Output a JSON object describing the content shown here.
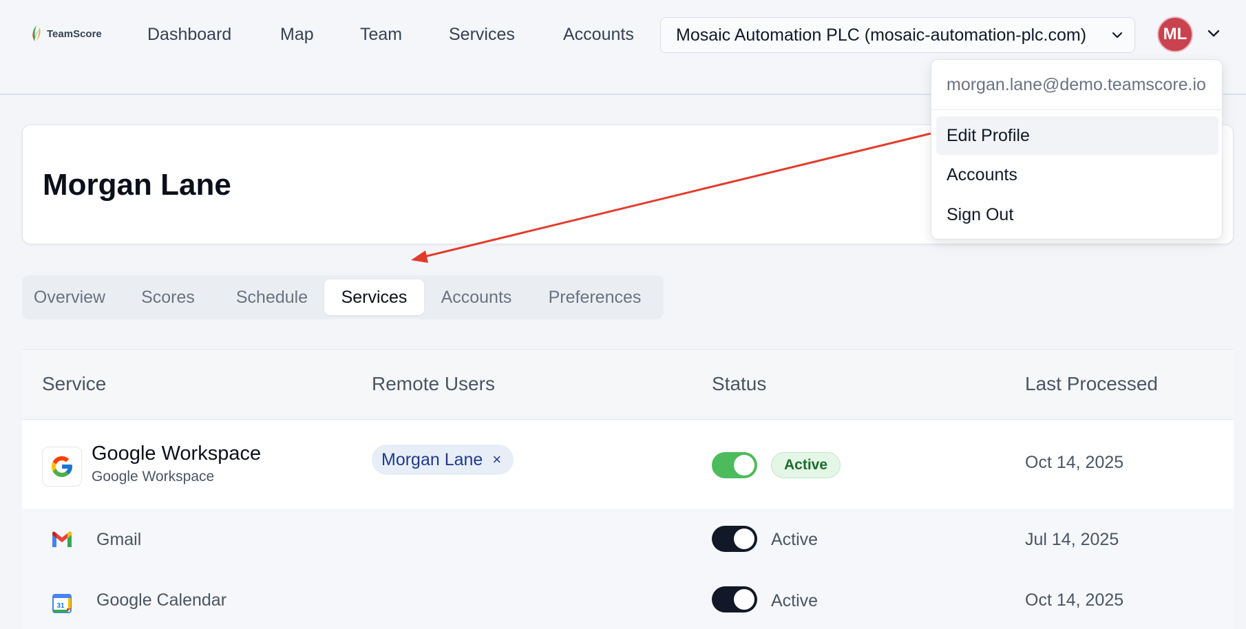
{
  "app": {
    "logo_text": "TeamScore",
    "accent": "#c8434f",
    "arrow_color": "#e23b2a"
  },
  "nav": {
    "items": [
      "Dashboard",
      "Map",
      "Team",
      "Services",
      "Accounts"
    ]
  },
  "account_selector": {
    "value": "Mosaic Automation PLC (mosaic-automation-plc.com)",
    "icon": "chevron-down-icon"
  },
  "user": {
    "initials": "ML",
    "name": "Morgan Lane",
    "email": "morgan.lane@demo.teamscore.io"
  },
  "user_menu": {
    "items": [
      "Edit Profile",
      "Accounts",
      "Sign Out"
    ],
    "highlighted": "Edit Profile"
  },
  "tabs": {
    "items": [
      "Overview",
      "Scores",
      "Schedule",
      "Services",
      "Accounts",
      "Preferences"
    ],
    "active": "Services"
  },
  "table": {
    "headers": [
      "Service",
      "Remote Users",
      "Status",
      "Last Processed"
    ],
    "main_row": {
      "title": "Google Workspace",
      "subtitle": "Google Workspace",
      "remote_user": "Morgan Lane",
      "remove_glyph": "×",
      "status": "Active",
      "toggle_on": true,
      "last_processed": "Oct 14, 2025"
    },
    "sub_rows": [
      {
        "name": "Gmail",
        "icon": "gmail-icon",
        "status": "Active",
        "toggle_on": true,
        "last_processed": "Jul 14, 2025"
      },
      {
        "name": "Google Calendar",
        "icon": "google-calendar-icon",
        "calendar_day": "31",
        "status": "Active",
        "toggle_on": true,
        "last_processed": "Oct 14, 2025"
      }
    ]
  }
}
